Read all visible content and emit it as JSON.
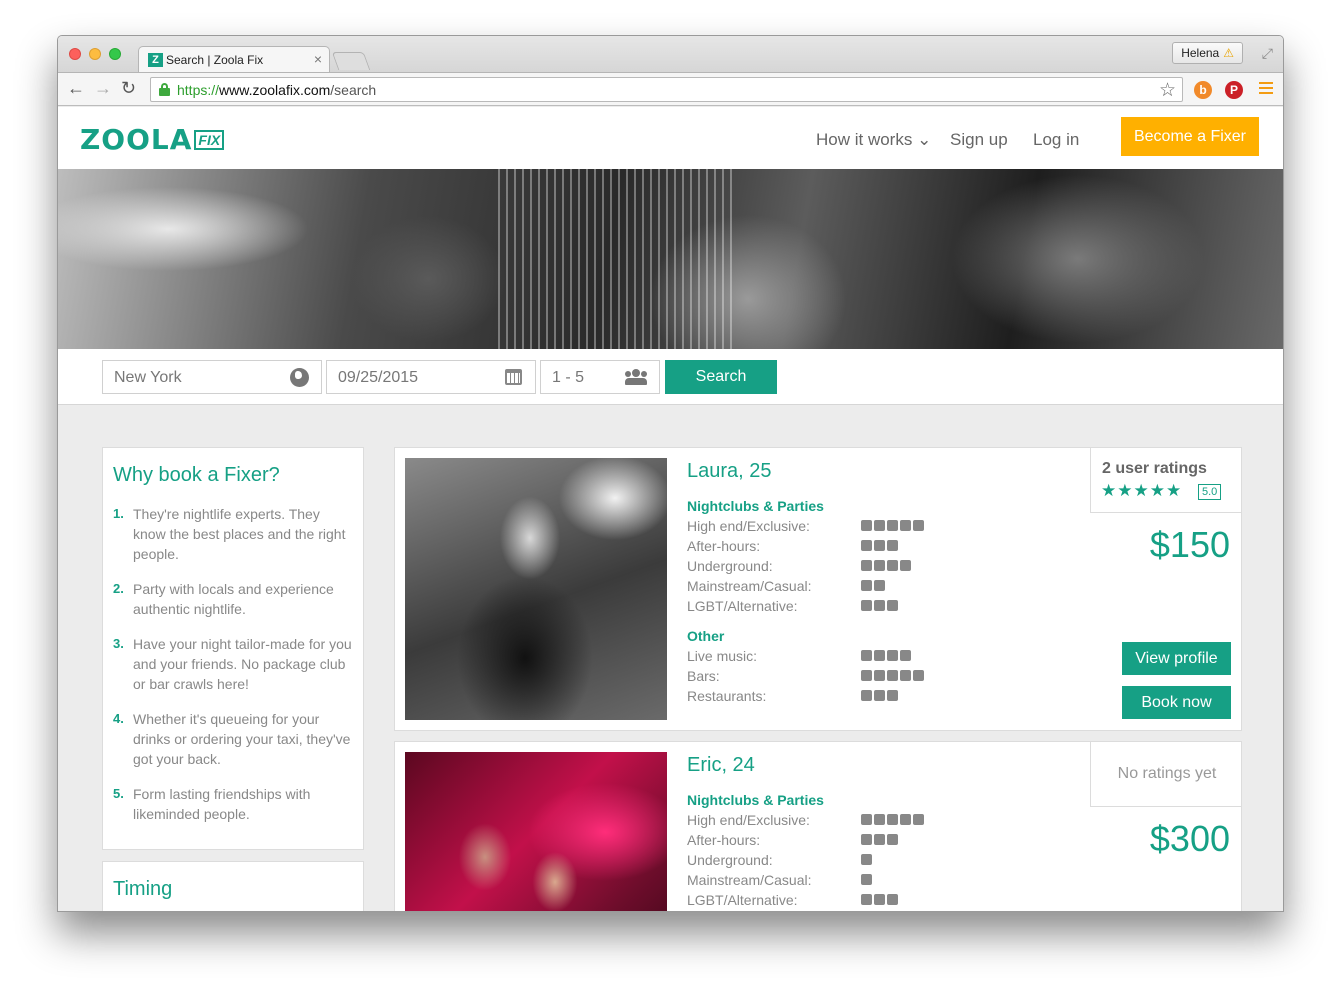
{
  "browser": {
    "tab_title": "Search | Zoola Fix",
    "tab_favicon": "Z",
    "tab_close": "×",
    "profile_name": "Helena",
    "profile_warning": "⚠",
    "url_protocol": "https://",
    "url_host": "www.zoolafix.com",
    "url_path": "/search",
    "ext_b": "b",
    "ext_p": "P"
  },
  "header": {
    "logo_main": "ZOOLA",
    "logo_sub": "FIX",
    "nav_how": "How it works ⌄",
    "nav_signup": "Sign up",
    "nav_login": "Log in",
    "become_fixer": "Become a Fixer"
  },
  "search": {
    "location": "New York",
    "date": "09/25/2015",
    "group": "1 - 5",
    "button": "Search"
  },
  "sidebar": {
    "why_title": "Why book a Fixer?",
    "why_items": [
      {
        "num": "1.",
        "text": "They're nightlife experts. They know the best places and the right people."
      },
      {
        "num": "2.",
        "text": "Party with locals and experience authentic nightlife."
      },
      {
        "num": "3.",
        "text": "Have your night tailor-made for you and your friends. No package club or bar crawls here!"
      },
      {
        "num": "4.",
        "text": "Whether it's queueing for your drinks or ordering your taxi, they've got your back."
      },
      {
        "num": "5.",
        "text": "Form lasting friendships with likeminded people."
      }
    ],
    "timing_title": "Timing"
  },
  "fixers": [
    {
      "name": "Laura, 25",
      "rating_count": "2 user ratings",
      "stars": "★★★★★",
      "score": "5.0",
      "price": "$150",
      "view_profile": "View profile",
      "book_now": "Book now",
      "cat1_title": "Nightclubs & Parties",
      "cat1": [
        {
          "label": "High end/Exclusive:",
          "level": 5
        },
        {
          "label": "After-hours:",
          "level": 3
        },
        {
          "label": "Underground:",
          "level": 4
        },
        {
          "label": "Mainstream/Casual:",
          "level": 2
        },
        {
          "label": "LGBT/Alternative:",
          "level": 3
        }
      ],
      "cat2_title": "Other",
      "cat2": [
        {
          "label": "Live music:",
          "level": 4
        },
        {
          "label": "Bars:",
          "level": 5
        },
        {
          "label": "Restaurants:",
          "level": 3
        }
      ]
    },
    {
      "name": "Eric, 24",
      "no_ratings": "No ratings yet",
      "price": "$300",
      "cat1_title": "Nightclubs & Parties",
      "cat1": [
        {
          "label": "High end/Exclusive:",
          "level": 5
        },
        {
          "label": "After-hours:",
          "level": 3
        },
        {
          "label": "Underground:",
          "level": 1
        },
        {
          "label": "Mainstream/Casual:",
          "level": 1
        },
        {
          "label": "LGBT/Alternative:",
          "level": 3
        }
      ]
    }
  ],
  "colors": {
    "brand": "#16a085",
    "accent": "#ffb000"
  }
}
